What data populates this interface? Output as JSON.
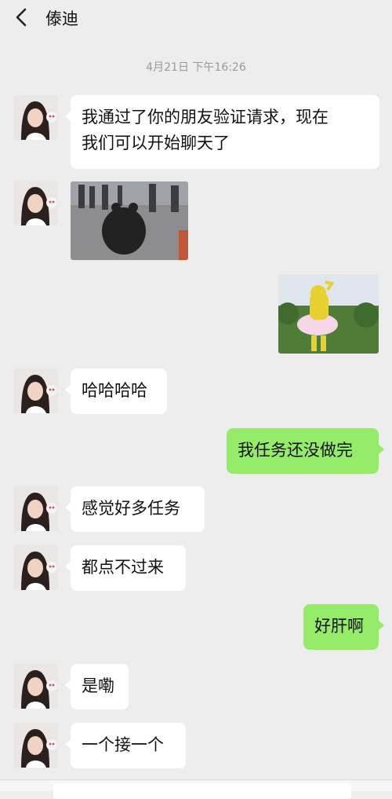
{
  "header": {
    "title": "傣迪"
  },
  "timestamp": "4月21日 下午16:26",
  "messages": [
    {
      "side": "left",
      "type": "text",
      "text": "我通过了你的朋友验证请求，现在\n我们可以开始聊天了"
    },
    {
      "side": "left",
      "type": "image"
    },
    {
      "side": "right",
      "type": "image"
    },
    {
      "side": "left",
      "type": "text",
      "text": "哈哈哈哈"
    },
    {
      "side": "right",
      "type": "text",
      "text": "我任务还没做完"
    },
    {
      "side": "left",
      "type": "text",
      "text": "感觉好多任务"
    },
    {
      "side": "left",
      "type": "text",
      "text": "都点不过来"
    },
    {
      "side": "right",
      "type": "text",
      "text": "好肝啊"
    },
    {
      "side": "left",
      "type": "text",
      "text": "是嘞"
    },
    {
      "side": "left",
      "type": "text",
      "text": "一个接一个"
    }
  ],
  "colors": {
    "background": "#ededed",
    "sent_bubble": "#95ec69",
    "received_bubble": "#ffffff"
  },
  "icons": {
    "back": "chevron-left-icon",
    "avatar": "contact-avatar"
  }
}
